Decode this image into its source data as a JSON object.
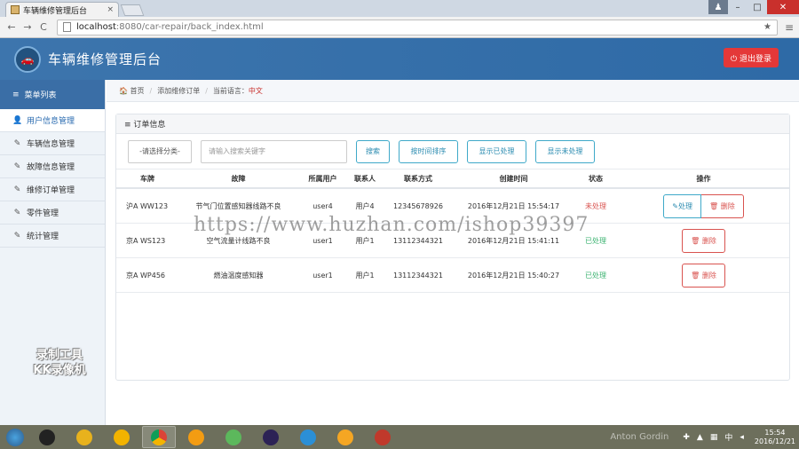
{
  "browser": {
    "tab_title": "车辆维修管理后台",
    "tab_close": "×",
    "url_host": "localhost",
    "url_rest": ":8080/car-repair/back_index.html",
    "back": "←",
    "forward": "→",
    "reload": "C",
    "omnibox_right": "★",
    "menu": "≡",
    "win_user": "♟",
    "win_min": "–",
    "win_max": "□",
    "win_close": "✕"
  },
  "header": {
    "logo_glyph": "🚗",
    "title": "车辆维修管理后台",
    "logout_label": "⏻ 退出登录"
  },
  "sidebar": {
    "head_label": "菜单列表",
    "head_icon": "≡",
    "items": [
      {
        "label": "用户信息管理",
        "icon": "👤"
      },
      {
        "label": "车辆信息管理",
        "icon": "✎"
      },
      {
        "label": "故障信息管理",
        "icon": "✎"
      },
      {
        "label": "维修订单管理",
        "icon": "✎"
      },
      {
        "label": "零件管理",
        "icon": "✎"
      },
      {
        "label": "统计管理",
        "icon": "✎"
      }
    ],
    "recorder_line1": "录制工具",
    "recorder_line2": "KK录像机"
  },
  "breadcrumb": {
    "home": "🏠 首页",
    "sep": "/",
    "page": "添加维修订单",
    "lang_prefix": "当前语言：",
    "lang_value": "中文"
  },
  "panel": {
    "title": "≡ 订单信息",
    "select_placeholder": "-请选择分类-",
    "search_placeholder": "请输入搜索关键字",
    "btn_search": "搜索",
    "btn_sort_time": "按时间排序",
    "btn_show_done": "显示已处理",
    "btn_show_pending": "显示未处理"
  },
  "table": {
    "headers": [
      "车牌",
      "故障",
      "所属用户",
      "联系人",
      "联系方式",
      "创建时间",
      "状态",
      "操作"
    ],
    "rows": [
      {
        "plate": "沪A WW123",
        "fault": "节气门位置感知器线路不良",
        "user": "user4",
        "contact": "用户4",
        "phone": "12345678926",
        "created": "2016年12月21日 15:54:17",
        "status": "未处理",
        "status_type": "pending"
      },
      {
        "plate": "京A WS123",
        "fault": "空气流量计线路不良",
        "user": "user1",
        "contact": "用户1",
        "phone": "13112344321",
        "created": "2016年12月21日 15:41:11",
        "status": "已处理",
        "status_type": "done"
      },
      {
        "plate": "京A WP456",
        "fault": "燃油温度感知器",
        "user": "user1",
        "contact": "用户1",
        "phone": "13112344321",
        "created": "2016年12月21日 15:40:27",
        "status": "已处理",
        "status_type": "done"
      }
    ],
    "btn_process": "✎处理",
    "btn_delete": "🗑 删除"
  },
  "watermark": "https://www.huzhan.com/ishop39397",
  "taskbar": {
    "tray_ghost": "Anton Gordin",
    "tray_lang": "中",
    "time": "15:54",
    "date": "2016/12/21"
  },
  "colors": {
    "header_blue": "#2e6aa6",
    "logout_red": "#e43838",
    "info_blue": "#3fa9c9",
    "danger_red": "#d9534f",
    "done_green": "#3cb371"
  }
}
